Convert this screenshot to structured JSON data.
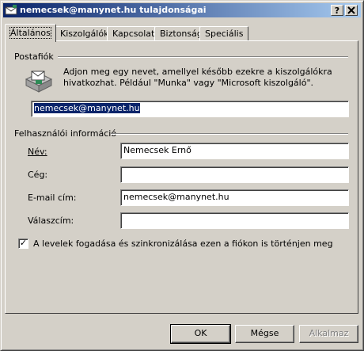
{
  "window": {
    "title": "nemecsek@manynet.hu tulajdonságai",
    "help_button": "?",
    "close_button": "X"
  },
  "tabs": [
    {
      "label": "Általános",
      "active": true
    },
    {
      "label": "Kiszolgálók",
      "active": false
    },
    {
      "label": "Kapcsolat",
      "active": false
    },
    {
      "label": "Biztonság",
      "active": false
    },
    {
      "label": "Speciális",
      "active": false
    }
  ],
  "mail_account": {
    "group_title": "Postafiók",
    "description_line1": "Adjon meg egy nevet, amellyel később ezekre a kiszolgálókra",
    "description_line2": "hivatkozhat. Például \"Munka\" vagy \"Microsoft kiszolgáló\".",
    "account_name_value": "nemecsek@manynet.hu",
    "icon": "mail-account-icon"
  },
  "user_info": {
    "group_title": "Felhasználói információ",
    "fields": [
      {
        "label": "Név:",
        "value": ""
      },
      {
        "label": "Cég:",
        "value": ""
      },
      {
        "label": "E-mail cím:",
        "value": "nemecsek@manynet.hu"
      },
      {
        "label": "Válaszcím:",
        "value": ""
      }
    ],
    "name_value": "Nemecsek Ernő"
  },
  "sync_checkbox": {
    "checked": true,
    "label": "A levelek fogadása és szinkronizálása ezen a fiókon is történjen meg"
  },
  "buttons": {
    "ok": "OK",
    "cancel": "Mégse",
    "apply": "Alkalmaz"
  }
}
